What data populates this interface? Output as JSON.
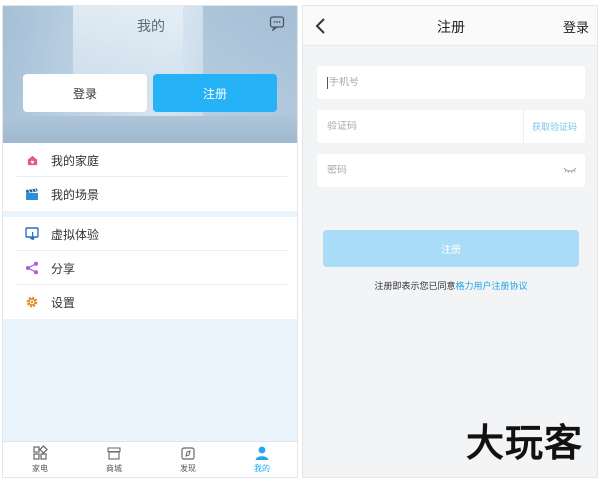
{
  "left": {
    "header": {
      "title": "我的",
      "message_icon": "chat-bubble-icon"
    },
    "buttons": {
      "login": "登录",
      "register": "注册"
    },
    "menu": [
      {
        "label": "我的家庭",
        "icon": "home-heart-icon",
        "color": "#e9558f"
      },
      {
        "label": "我的场景",
        "icon": "clapperboard-icon",
        "color": "#2a8fd8"
      },
      {
        "label": "虚拟体验",
        "icon": "touch-screen-icon",
        "color": "#2a6fc6"
      },
      {
        "label": "分享",
        "icon": "share-icon",
        "color": "#b25ad6"
      },
      {
        "label": "设置",
        "icon": "gear-icon",
        "color": "#e48a1e"
      }
    ],
    "tabs": [
      {
        "label": "家电",
        "icon": "grid-icon",
        "active": false
      },
      {
        "label": "商城",
        "icon": "store-icon",
        "active": false
      },
      {
        "label": "发现",
        "icon": "compass-icon",
        "active": false
      },
      {
        "label": "我的",
        "icon": "person-icon",
        "active": true
      }
    ]
  },
  "right": {
    "nav": {
      "title": "注册",
      "login": "登录"
    },
    "form": {
      "phone_placeholder": "手机号",
      "code_placeholder": "验证码",
      "get_code": "获取验证码",
      "password_placeholder": "密码",
      "submit": "注册",
      "agree_text": "注册即表示您已同意",
      "agree_link": "格力用户注册协议"
    }
  },
  "watermark": "大玩客",
  "colors": {
    "accent": "#25b2f6",
    "submit_disabled": "#a9dcf6",
    "link": "#1ea1e6"
  }
}
